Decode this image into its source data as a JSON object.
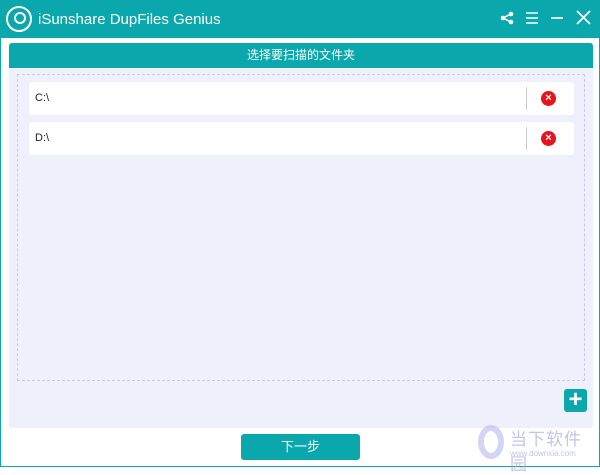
{
  "window": {
    "title": "iSunshare DupFiles Genius"
  },
  "panel": {
    "header": "选择要扫描的文件夹",
    "folders": [
      {
        "path": "C:\\"
      },
      {
        "path": "D:\\"
      }
    ]
  },
  "buttons": {
    "add": "+",
    "next": "下一步",
    "delete": "×"
  },
  "watermark": {
    "name": "当下软件园",
    "url": "www.downxia.com"
  },
  "colors": {
    "accent": "#0aa8ac",
    "panel": "#eef0fc",
    "delete": "#e8131d"
  }
}
